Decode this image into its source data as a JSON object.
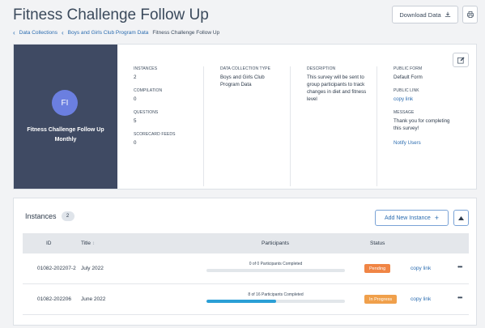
{
  "header": {
    "title": "Fitness Challenge Follow Up",
    "download_label": "Download Data"
  },
  "breadcrumb": {
    "items": [
      "Data Collections",
      "Boys and Girls Club Program Data"
    ],
    "current": "Fitness Challenge Follow Up"
  },
  "profile": {
    "initials": "FI",
    "name": "Fitness Challenge Follow Up",
    "frequency": "Monthly",
    "avatar_color": "#6b7fe0",
    "panel_color": "#3f4a63"
  },
  "stats": {
    "instances_label": "INSTANCES",
    "instances": "2",
    "compilation_label": "COMPILATION",
    "compilation": "0",
    "questions_label": "QUESTIONS",
    "questions": "5",
    "scorecard_label": "SCORECARD FEEDS",
    "scorecard": "0"
  },
  "collection_type": {
    "label": "DATA COLLECTION TYPE",
    "value": "Boys and Girls Club Program Data"
  },
  "description": {
    "label": "DESCRIPTION",
    "value": "This survey will be sent to group participants to track changes in diet and fitness level"
  },
  "public": {
    "form_label": "PUBLIC FORM",
    "form_value": "Default Form",
    "link_label": "PUBLIC LINK",
    "link_value": "copy link",
    "message_label": "MESSAGE",
    "message_value": "Thank you for completing this survey!",
    "notify_label": "Notify Users"
  },
  "instances": {
    "title": "Instances",
    "count": "2",
    "add_label": "Add New Instance",
    "columns": {
      "id": "ID",
      "title": "Title",
      "participants": "Participants",
      "status": "Status"
    },
    "rows": [
      {
        "id": "01082-202207-2",
        "title": "July 2022",
        "participants": "0 of 0 Participants Completed",
        "progress": 0,
        "status": "Pending",
        "status_color": "#f08545",
        "link": "copy link"
      },
      {
        "id": "01082-202206",
        "title": "June 2022",
        "participants": "8 of 16 Participants Completed",
        "progress": 0.5,
        "status": "In Progress",
        "status_color": "#f0a04b",
        "link": "copy link"
      }
    ]
  }
}
